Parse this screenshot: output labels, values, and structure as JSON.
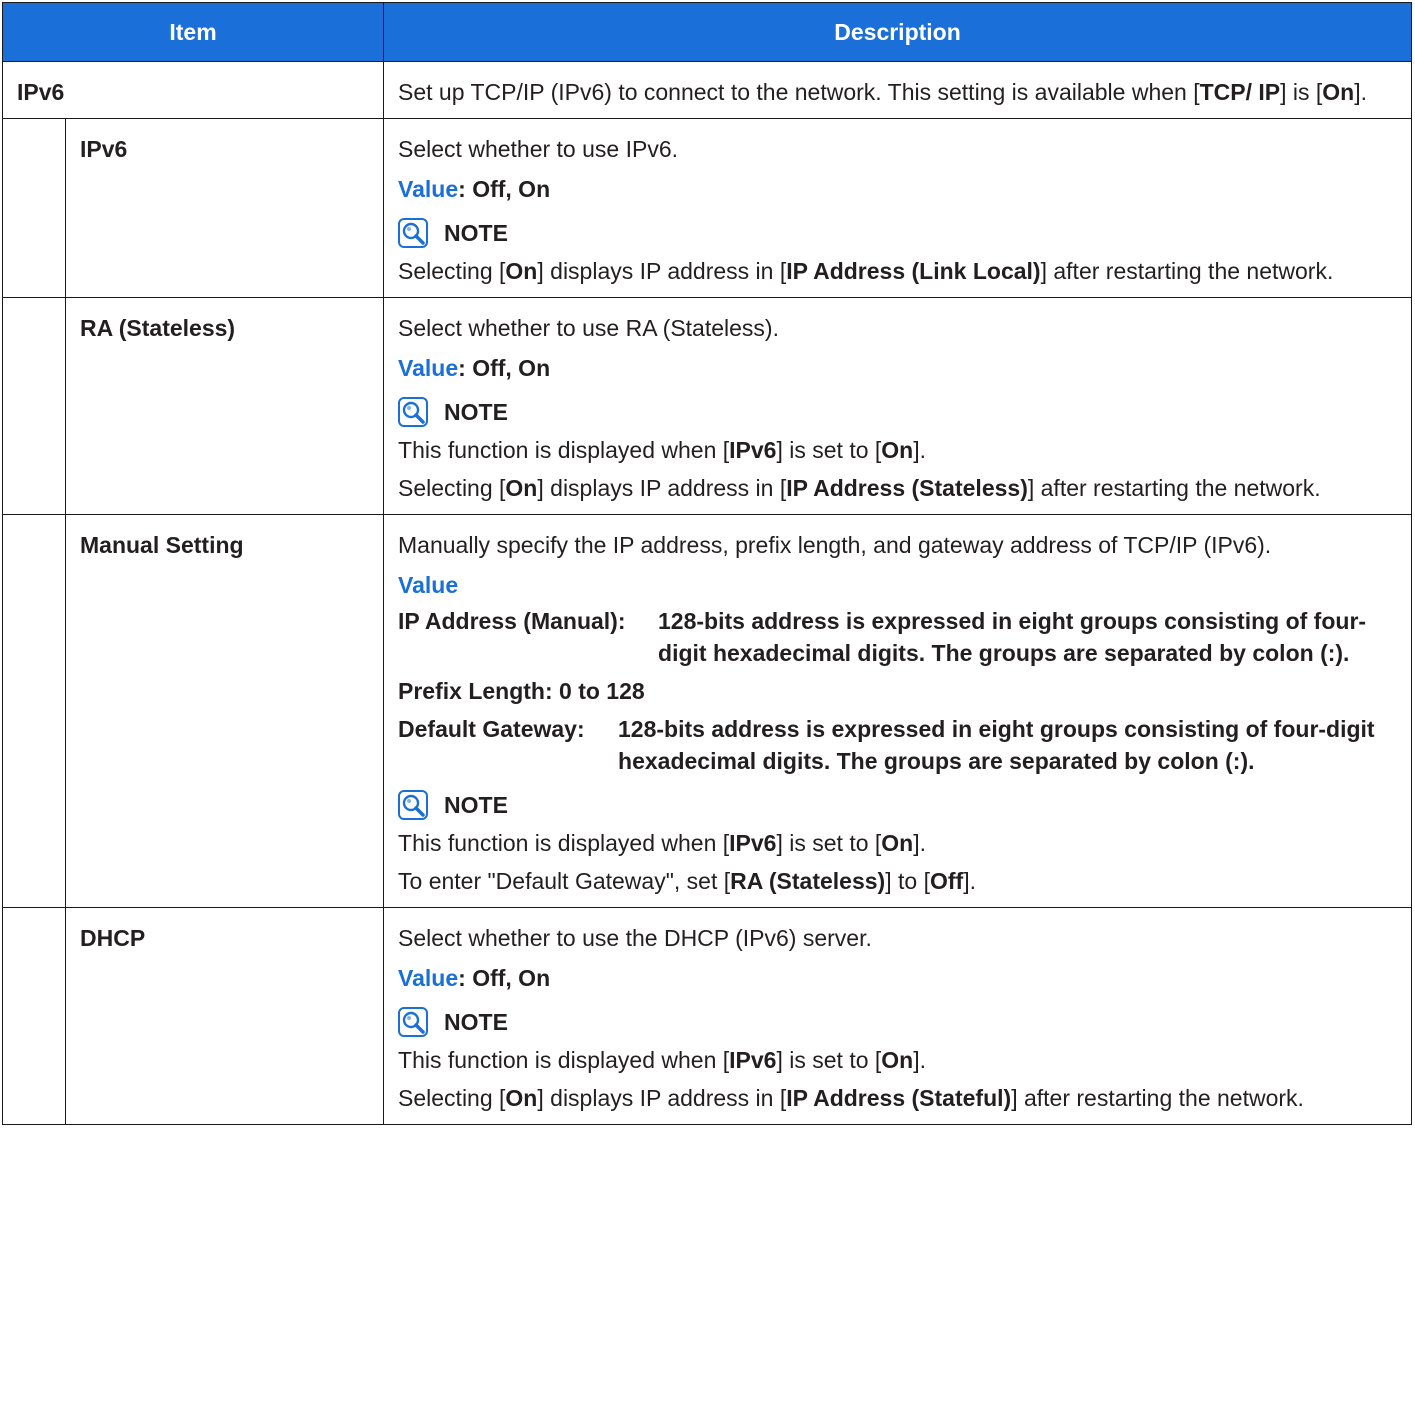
{
  "header": {
    "item": "Item",
    "description": "Description"
  },
  "ipv6_group": {
    "label": "IPv6",
    "desc_1": "Set up TCP/IP (IPv6) to connect to the network. This setting is available when [",
    "desc_b1": "TCP/ IP",
    "desc_2": "] is [",
    "desc_b2": "On",
    "desc_3": "]."
  },
  "note_label": "NOTE",
  "value_key": "Value",
  "value_sep": ": ",
  "rows": {
    "ipv6": {
      "label": "IPv6",
      "desc": "Select whether to use IPv6.",
      "value": "Off, On",
      "note": {
        "p1": "Selecting [",
        "b1": "On",
        "p2": "] displays IP address in [",
        "b2": "IP Address (Link Local)",
        "p3": "] after restarting the network."
      }
    },
    "ra": {
      "label": "RA (Stateless)",
      "desc": "Select whether to use RA (Stateless).",
      "value": "Off, On",
      "note1": {
        "p1": "This function is displayed when [",
        "b1": "IPv6",
        "p2": "] is set to [",
        "b2": "On",
        "p3": "]."
      },
      "note2": {
        "p1": "Selecting [",
        "b1": "On",
        "p2": "] displays IP address in [",
        "b2": "IP Address (Stateless)",
        "p3": "] after restarting the network."
      }
    },
    "manual": {
      "label": "Manual Setting",
      "desc": "Manually specify the IP address, prefix length, and gateway address of TCP/IP (IPv6).",
      "values": [
        {
          "label": "IP Address (Manual): ",
          "text": "128-bits address is expressed in eight groups consisting of four-digit hexadecimal digits. The groups are separated by colon (:)."
        },
        {
          "label": "Prefix Length: 0 to 128",
          "text": ""
        },
        {
          "label": "Default Gateway:",
          "text": "128-bits address is expressed in eight groups consisting of four-digit hexadecimal digits. The groups are separated by colon (:)."
        }
      ],
      "note1": {
        "p1": "This function is displayed when [",
        "b1": "IPv6",
        "p2": "] is set to [",
        "b2": "On",
        "p3": "]."
      },
      "note2": {
        "p1": "To enter \"Default Gateway\", set [",
        "b1": "RA (Stateless)",
        "p2": "] to [",
        "b2": "Off",
        "p3": "]."
      }
    },
    "dhcp": {
      "label": "DHCP",
      "desc": "Select whether to use the DHCP (IPv6) server.",
      "value": "Off, On",
      "note1": {
        "p1": "This function is displayed when [",
        "b1": "IPv6",
        "p2": "] is set to [",
        "b2": "On",
        "p3": "]."
      },
      "note2": {
        "p1": "Selecting [",
        "b1": "On",
        "p2": "] displays IP address in [",
        "b2": "IP Address (Stateful)",
        "p3": "] after restarting the network."
      }
    }
  }
}
